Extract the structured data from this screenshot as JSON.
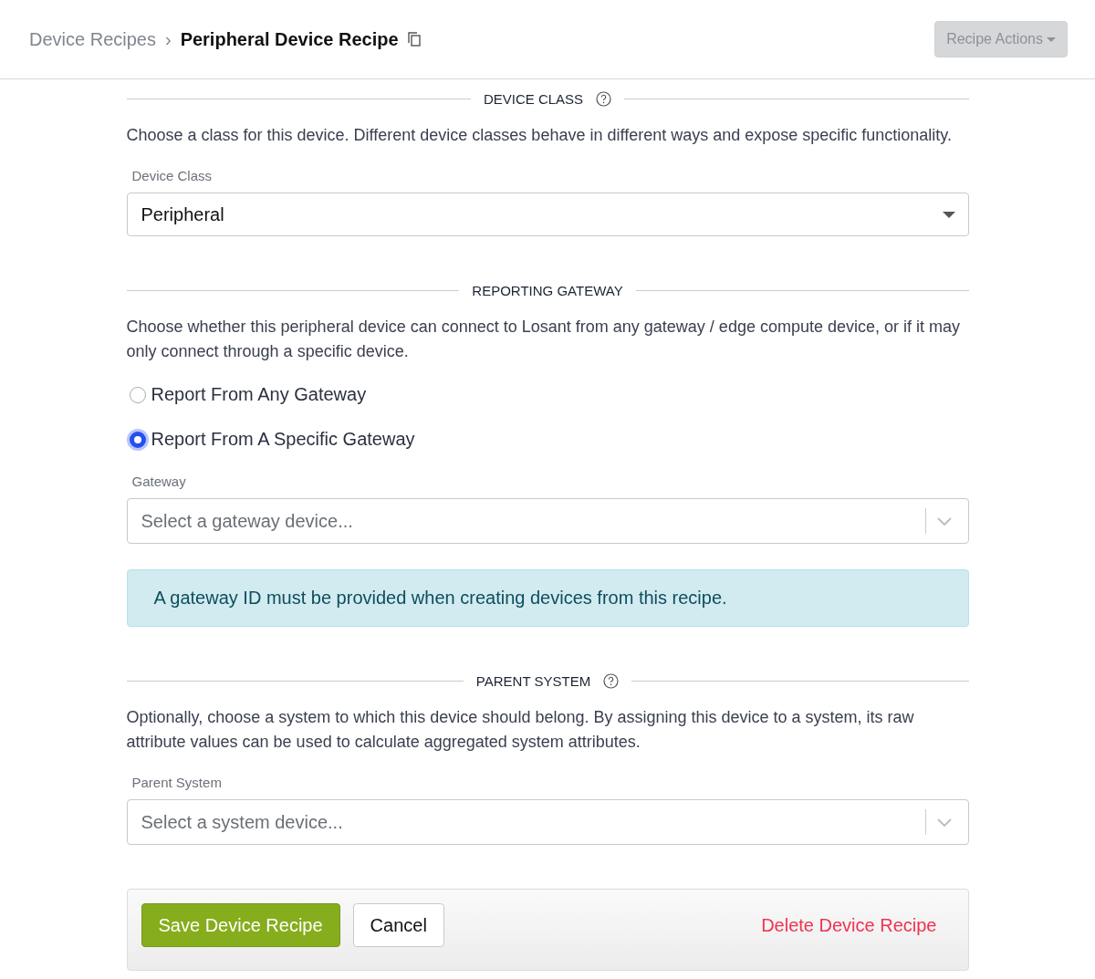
{
  "header": {
    "separator": "›",
    "breadcrumb": [
      {
        "label": "Device Recipes",
        "current": false
      },
      {
        "label": "Peripheral Device Recipe",
        "current": true
      }
    ],
    "actions_button": {
      "label": "Recipe Actions",
      "disabled": true
    }
  },
  "sections": [
    {
      "title": "DEVICE CLASS",
      "help": true,
      "description": "Choose a class for this device. Different device classes behave in different ways and expose specific functionality.",
      "items": [
        {
          "kind": "dropdown",
          "label": "Device Class",
          "value": "Peripheral"
        }
      ]
    },
    {
      "title": "REPORTING GATEWAY",
      "help": false,
      "description": "Choose whether this peripheral device can connect to Losant from any gateway / edge compute device, or if it may only connect through a specific device.",
      "items": [
        {
          "kind": "radio",
          "label": "Report From Any Gateway",
          "selected": false
        },
        {
          "kind": "radio",
          "label": "Report From A Specific Gateway",
          "selected": true
        },
        {
          "kind": "combo",
          "label": "Gateway",
          "placeholder": "Select a gateway device..."
        },
        {
          "kind": "alert",
          "text": "A gateway ID must be provided when creating devices from this recipe."
        }
      ]
    },
    {
      "title": "PARENT SYSTEM",
      "help": true,
      "description": "Optionally, choose a system to which this device should belong. By assigning this device to a system, its raw attribute values can be used to calculate aggregated system attributes.",
      "items": [
        {
          "kind": "combo",
          "label": "Parent System",
          "placeholder": "Select a system device..."
        }
      ]
    }
  ],
  "footer": {
    "save": "Save Device Recipe",
    "cancel": "Cancel",
    "delete": "Delete Device Recipe"
  }
}
